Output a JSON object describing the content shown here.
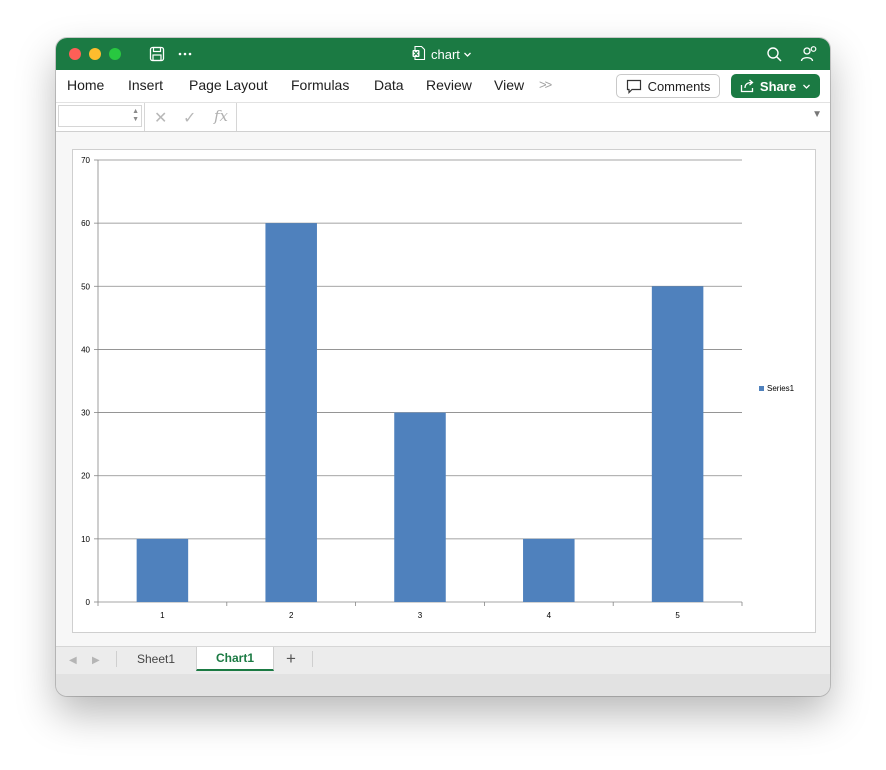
{
  "window": {
    "title": "chart",
    "title_icon": "excel-document-icon"
  },
  "ribbon": {
    "tabs": [
      "Home",
      "Insert",
      "Page Layout",
      "Formulas",
      "Data",
      "Review",
      "View"
    ],
    "more_label": ">>",
    "comments_label": "Comments",
    "share_label": "Share"
  },
  "formula_bar": {
    "name_box_value": "",
    "formula_value": "",
    "fx_label": "fx"
  },
  "chart_data": {
    "type": "bar",
    "categories": [
      "1",
      "2",
      "3",
      "4",
      "5"
    ],
    "series": [
      {
        "name": "Series1",
        "values": [
          10,
          60,
          30,
          10,
          50
        ],
        "color": "#4f81bd"
      }
    ],
    "ylim": [
      0,
      70
    ],
    "yticks": [
      0,
      10,
      20,
      30,
      40,
      50,
      60,
      70
    ],
    "title": "",
    "xlabel": "",
    "ylabel": "",
    "grid": true,
    "legend_position": "right"
  },
  "sheets": {
    "tabs": [
      "Sheet1",
      "Chart1"
    ],
    "active": "Chart1",
    "add_label": "+"
  },
  "colors": {
    "accent": "#1b7a43",
    "bar": "#4f81bd"
  }
}
